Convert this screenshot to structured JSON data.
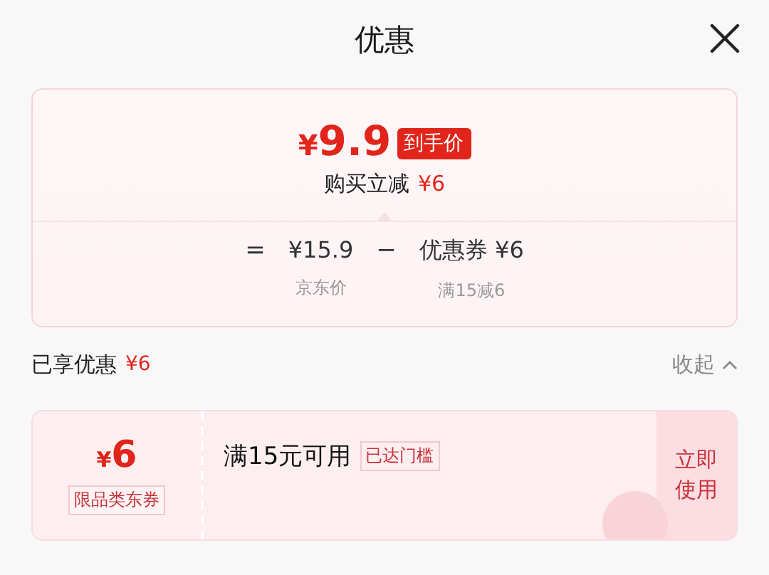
{
  "header": {
    "title": "优惠"
  },
  "summary": {
    "price_symbol": "¥",
    "price": "9.9",
    "price_badge": "到手价",
    "saving_label": "购买立减",
    "saving": "¥6",
    "formula": [
      {
        "kind": "op",
        "text": "="
      },
      {
        "kind": "term",
        "value": "¥15.9",
        "caption": "京东价"
      },
      {
        "kind": "op",
        "text": "−"
      },
      {
        "kind": "term",
        "value": "优惠券 ¥6",
        "caption": "满15减6"
      }
    ]
  },
  "enjoyed": {
    "label": "已享优惠",
    "amount": "¥6",
    "toggle": "收起",
    "expanded": true
  },
  "coupons": [
    {
      "amount_symbol": "¥",
      "amount": "6",
      "type": "限品类东券",
      "condition": "满15元可用",
      "status": "已达门槛",
      "action": "立即使用"
    }
  ]
}
